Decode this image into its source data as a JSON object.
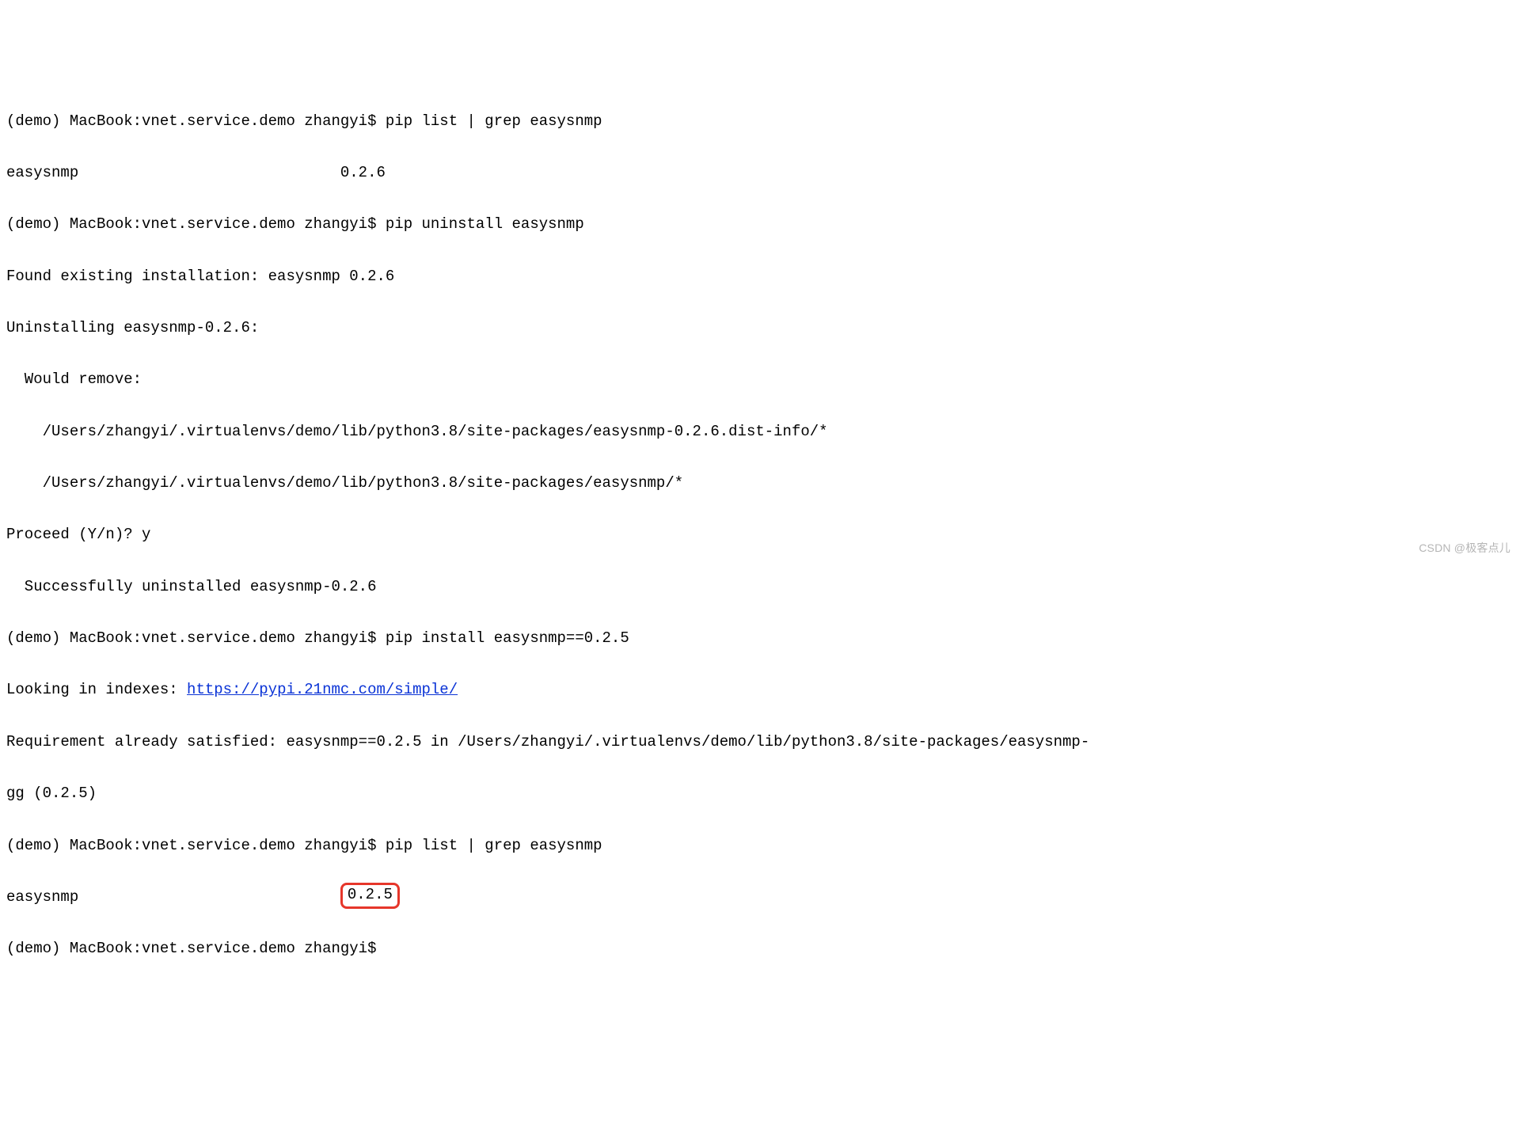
{
  "prompt": "(demo) MacBook:vnet.service.demo zhangyi$ ",
  "commands": {
    "cmd1": "pip list | grep easysnmp",
    "cmd2": "pip uninstall easysnmp",
    "cmd3": "pip install easysnmp==0.2.5",
    "cmd4": "pip list | grep easysnmp"
  },
  "listing1": {
    "name": "easysnmp",
    "version": "0.2.6",
    "name_col_width": 37
  },
  "uninstall": {
    "found": "Found existing installation: easysnmp 0.2.6",
    "head": "Uninstalling easysnmp-0.2.6:",
    "would_remove": "  Would remove:",
    "path1": "    /Users/zhangyi/.virtualenvs/demo/lib/python3.8/site-packages/easysnmp-0.2.6.dist-info/*",
    "path2": "    /Users/zhangyi/.virtualenvs/demo/lib/python3.8/site-packages/easysnmp/*",
    "proceed_prompt": "Proceed (Y/n)? ",
    "proceed_answer": "y",
    "success": "  Successfully uninstalled easysnmp-0.2.6"
  },
  "install": {
    "looking_prefix": "Looking in indexes: ",
    "index_url": "https://pypi.21nmc.com/simple/",
    "satisfied_line1": "Requirement already satisfied: easysnmp==0.2.5 in /Users/zhangyi/.virtualenvs/demo/lib/python3.8/site-packages/easysnmp-",
    "satisfied_line2": "gg (0.2.5)"
  },
  "listing2": {
    "name": "easysnmp",
    "version": "0.2.5",
    "name_col_width": 37
  },
  "watermark": "CSDN @极客点儿"
}
